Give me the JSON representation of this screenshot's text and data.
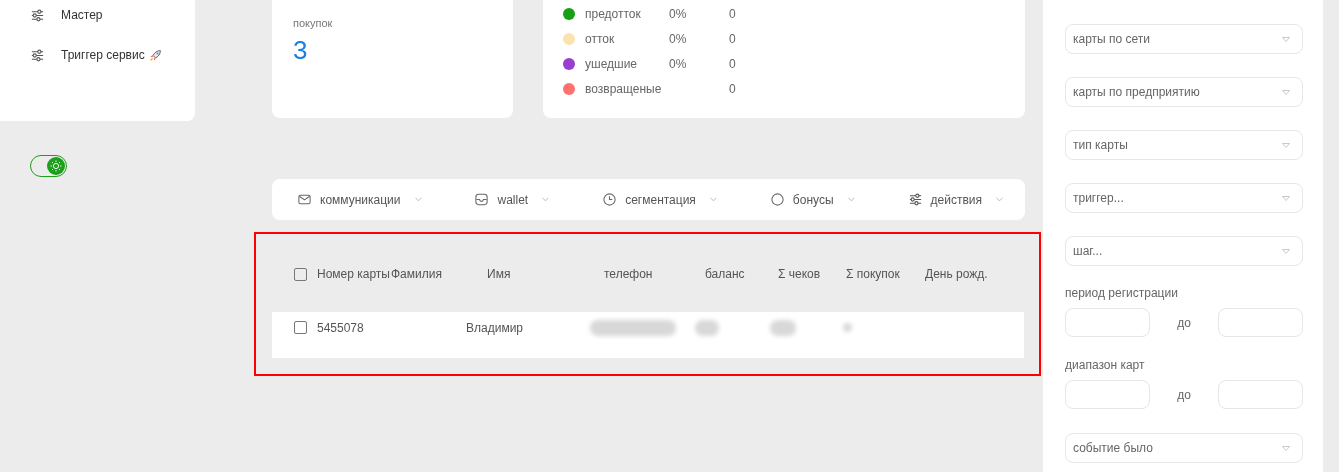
{
  "sidebar": {
    "items": [
      {
        "label": "Мастер"
      },
      {
        "label": "Триггер сервис"
      }
    ]
  },
  "theme_toggle": {
    "on": true
  },
  "purchases_card": {
    "label": "покупок",
    "value": "3"
  },
  "segments": [
    {
      "name": "предотток",
      "percent": "0%",
      "count": "0",
      "color": "#16a016"
    },
    {
      "name": "отток",
      "percent": "0%",
      "count": "0",
      "color": "#fbe3b0"
    },
    {
      "name": "ушедшие",
      "percent": "0%",
      "count": "0",
      "color": "#9a3ed0"
    },
    {
      "name": "возвращеные",
      "count": "0",
      "color": "#ff7070"
    }
  ],
  "toolbar": [
    {
      "label": "коммуникации"
    },
    {
      "label": "wallet"
    },
    {
      "label": "сегментация"
    },
    {
      "label": "бонусы"
    },
    {
      "label": "действия"
    }
  ],
  "table": {
    "select_all_checked": false,
    "columns": [
      "Номер карты",
      "Фамилия",
      "Имя",
      "телефон",
      "баланс",
      "Σ чеков",
      "Σ покупок",
      "День рожд."
    ],
    "rows": [
      {
        "checked": false,
        "card_number": "5455078",
        "first_name": "Владимир"
      }
    ]
  },
  "filters": [
    {
      "kind": "select",
      "placeholder": "карты по сети"
    },
    {
      "kind": "select",
      "placeholder": "карты по предприятию"
    },
    {
      "kind": "select",
      "placeholder": "тип карты"
    },
    {
      "kind": "select",
      "placeholder": "триггер..."
    },
    {
      "kind": "select",
      "placeholder": "шаг..."
    },
    {
      "kind": "range",
      "label": "период регистрации",
      "separator": "до"
    },
    {
      "kind": "range",
      "label": "диапазон карт",
      "separator": "до"
    },
    {
      "kind": "select",
      "placeholder": "событие было"
    }
  ]
}
